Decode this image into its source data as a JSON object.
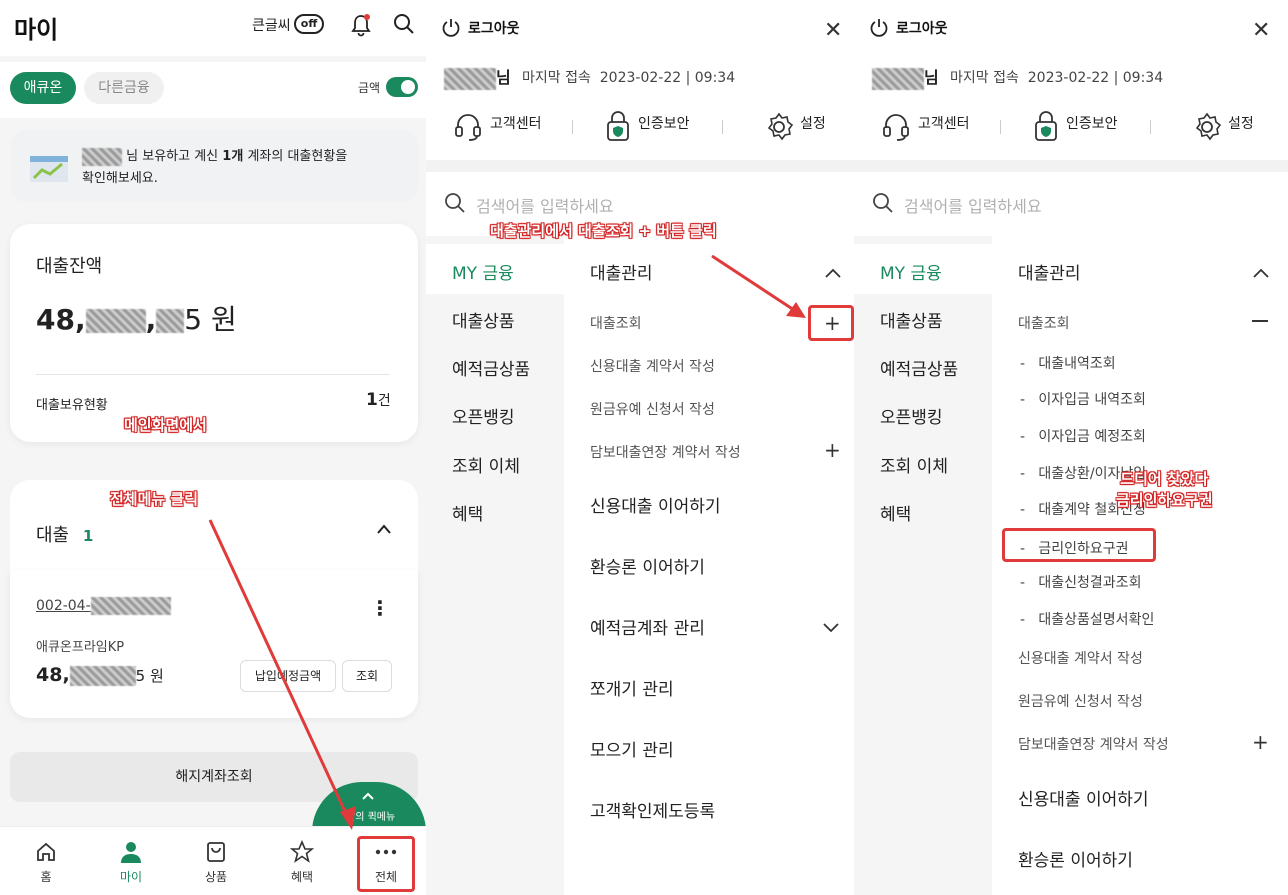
{
  "p1": {
    "title": "마이",
    "big_font": "큰글씨",
    "off": "off",
    "tab_active": "애큐온",
    "tab_other": "다른금융",
    "amount_label": "금액",
    "banner_line1_a": "님 보유하고 계신",
    "banner_bold": "1개",
    "banner_line1_b": "계좌의 대출현황을",
    "banner_line2": "확인해보세요.",
    "balance_label": "대출잔액",
    "balance_prefix": "48,",
    "balance_mid": ",",
    "balance_suffix": "5 원",
    "holdings_label": "대출보유현황",
    "holdings_count": "1",
    "holdings_unit": "건",
    "loan_title": "대출",
    "loan_count": "1",
    "account_prefix": "002-04-",
    "product": "애큐온프라임KP",
    "loan_amount_prefix": "48,",
    "loan_amount_suffix": "5 원",
    "btn_due": "납입예정금액",
    "btn_view": "조회",
    "closed_accounts": "해지계좌조회",
    "quick_menu": "만의 퀵메뉴",
    "nav": [
      "홈",
      "마이",
      "상품",
      "혜택",
      "전체"
    ]
  },
  "p2": {
    "logout": "로그아웃",
    "user_suffix": "님",
    "last_access": "마지막 접속",
    "date": "2023-02-22",
    "time": "09:34",
    "svc_customer": "고객센터",
    "svc_cert": "인증보안",
    "svc_settings": "설정",
    "search_placeholder": "검색어를 입력하세요",
    "left": [
      "MY 금융",
      "대출상품",
      "예적금상품",
      "오픈뱅킹",
      "조회 이체",
      "혜택"
    ],
    "section": "대출관리",
    "sub": [
      "대출조회",
      "신용대출 계약서 작성",
      "원금유예 신청서 작성",
      "담보대출연장 계약서 작성"
    ],
    "big": [
      "신용대출 이어하기",
      "환승론 이어하기",
      "예적금계좌 관리",
      "쪼개기 관리",
      "모으기 관리",
      "고객확인제도등록"
    ]
  },
  "p3": {
    "section": "대출관리",
    "sub_head": "대출조회",
    "dash": [
      "대출내역조회",
      "이자입금 내역조회",
      "이자입금 예정조회",
      "대출상환/이자납입",
      "대출계약 철회신청",
      "금리인하요구권",
      "대출신청결과조회",
      "대출상품설명서확인"
    ],
    "sub": [
      "신용대출 계약서 작성",
      "원금유예 신청서 작성",
      "담보대출연장 계약서 작성"
    ],
    "big": [
      "신용대출 이어하기",
      "환승론 이어하기"
    ]
  },
  "annotations": {
    "main_screen": "메인화면에서",
    "all_menu": "전체메뉴 클릭",
    "loan_plus": "대출관리에서 대출조회 + 버튼 클릭",
    "found_1": "드디어 찾았다",
    "found_2": "금리인하요구권"
  },
  "colors": {
    "green": "#1a8a5e",
    "red": "#e03a3a"
  }
}
